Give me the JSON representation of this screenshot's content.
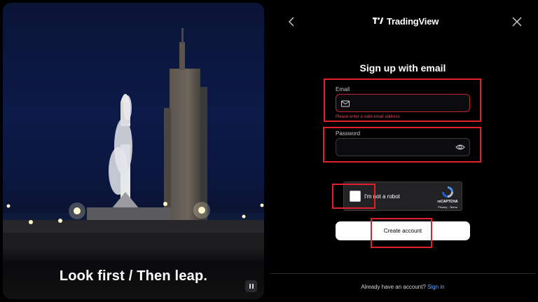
{
  "hero": {
    "tagline": "Look first / Then leap."
  },
  "header": {
    "logo_text": "TradingView"
  },
  "form": {
    "title": "Sign up with email",
    "email": {
      "label": "Email",
      "value": "",
      "placeholder": "",
      "error": "Please enter a valid email address"
    },
    "password": {
      "label": "Password",
      "value": "",
      "placeholder": ""
    },
    "captcha": {
      "label": "I'm not a robot",
      "brand": "reCAPTCHA",
      "links": "Privacy - Terms"
    },
    "submit_label": "Create account"
  },
  "footer": {
    "prompt": "Already have an account?",
    "signin_label": "Sign in"
  },
  "colors": {
    "accent_link": "#6ea8ff",
    "error": "#e0475a",
    "annotation": "#e0202a"
  },
  "icons": [
    "chevron-left-icon",
    "close-icon",
    "tradingview-logo-icon",
    "mail-icon",
    "eye-icon",
    "recaptcha-icon",
    "pause-icon"
  ]
}
